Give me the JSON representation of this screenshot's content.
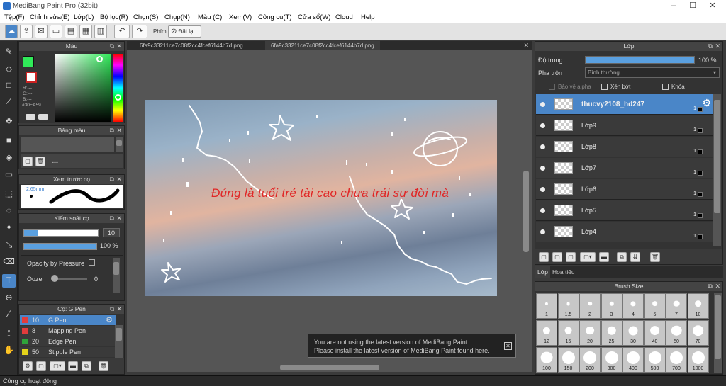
{
  "app": {
    "title": "MediBang Paint Pro (32bit)",
    "minimize": "–",
    "maximize": "☐",
    "close": "✕"
  },
  "menu": [
    "Tệp(F)",
    "Chỉnh sửa(E)",
    "Lớp(L)",
    "Bộ lọc(R)",
    "Chọn(S)",
    "Chụp(N)",
    "Màu (C)",
    "Xem(V)",
    "Công cụ(T)",
    "Cửa sổ(W)",
    "Cloud",
    "Help"
  ],
  "toolbar": {
    "phim_label": "Phím",
    "reset_label": "Đặt lại"
  },
  "color_panel": {
    "title": "Màu",
    "r": "R:---",
    "g": "G:---",
    "b": "B:---",
    "hex": "#30EA59",
    "accent": "#30ea59"
  },
  "palette_panel": {
    "title": "Bảng màu",
    "empty": "---"
  },
  "preview_panel": {
    "title": "Xem trước cọ",
    "size": "2.65mm"
  },
  "brush_control": {
    "title": "Kiểm soát cọ",
    "size_value": "10",
    "opacity_value": "100 %",
    "opacity_pressure": "Opacity by Pressure",
    "ooze_label": "Ooze",
    "ooze_value": "0"
  },
  "brush_list": {
    "title": "Cọ: G Pen",
    "items": [
      {
        "size": "10",
        "name": "G Pen",
        "color": "#e23c3c",
        "selected": true
      },
      {
        "size": "8",
        "name": "Mapping Pen",
        "color": "#e23c3c",
        "selected": false
      },
      {
        "size": "20",
        "name": "Edge Pen",
        "color": "#2fa33a",
        "selected": false
      },
      {
        "size": "50",
        "name": "Stipple Pen",
        "color": "#e3d21a",
        "selected": false
      }
    ]
  },
  "tabs": [
    "6fa9c33211ce7c08f2cc4fcef6144b7d.png",
    "6fa9c33211ce7c08f2cc4fcef6144b7d.png"
  ],
  "artwork": {
    "text": "Đúng là tuổi trẻ tài cao chưa trải sự đời mà"
  },
  "notice": {
    "line1": "You are not using the latest version of MediBang Paint.",
    "line2": "Please install the latest version of MediBang Paint found here.",
    "close": "✕"
  },
  "layer_panel": {
    "title": "Lớp",
    "opacity_label": "Độ trong",
    "opacity_value": "100 %",
    "opacity_fraction": 1.0,
    "blend_label": "Pha trộn",
    "blend_value": "Bình thường",
    "protect_alpha": "Bảo vệ alpha",
    "clipping": "Xén bớt",
    "lock": "Khóa",
    "layers": [
      {
        "name": "thucvy2108_hd247",
        "selected": true
      },
      {
        "name": "Lớp9",
        "selected": false
      },
      {
        "name": "Lớp8",
        "selected": false
      },
      {
        "name": "Lớp7",
        "selected": false
      },
      {
        "name": "Lớp6",
        "selected": false
      },
      {
        "name": "Lớp5",
        "selected": false
      },
      {
        "name": "Lớp4",
        "selected": false
      }
    ],
    "layer_badge": "1",
    "tab_layer": "Lớp",
    "tab_navigator": "Hoa tiêu"
  },
  "brush_size_panel": {
    "title": "Brush Size",
    "sizes": [
      "1",
      "1.5",
      "2",
      "3",
      "4",
      "5",
      "7",
      "10",
      "12",
      "15",
      "20",
      "25",
      "30",
      "40",
      "50",
      "70",
      "100",
      "150",
      "200",
      "300",
      "400",
      "500",
      "700",
      "1000"
    ]
  },
  "status": {
    "text": "Công cụ hoạt động"
  }
}
